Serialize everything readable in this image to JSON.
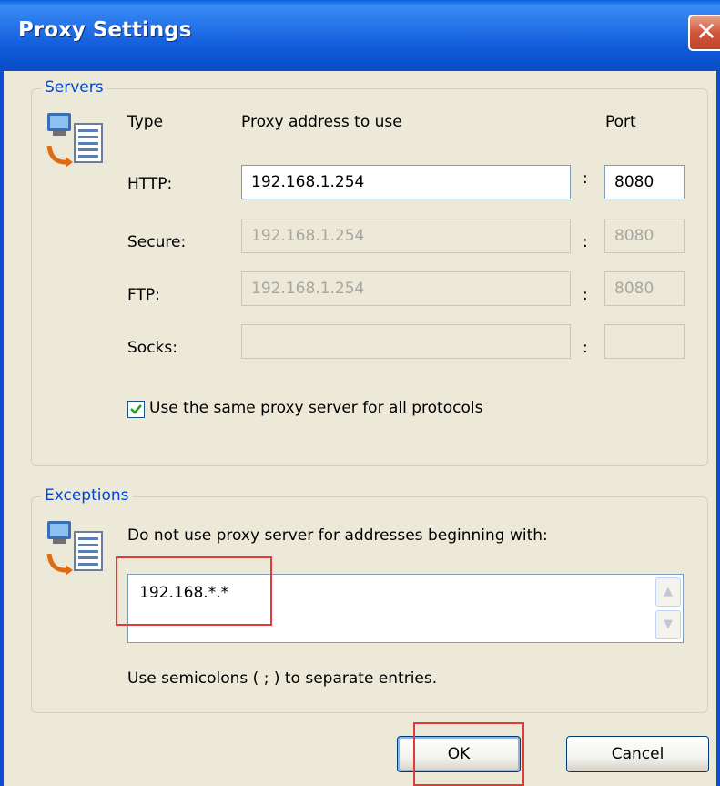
{
  "window": {
    "title": "Proxy Settings",
    "close_glyph": "✕"
  },
  "servers": {
    "group_label": "Servers",
    "icon": "network-computer-icon",
    "col_type": "Type",
    "col_address": "Proxy address to use",
    "col_port": "Port",
    "rows": [
      {
        "label": "HTTP:",
        "address": "192.168.1.254",
        "port": "8080",
        "enabled": true
      },
      {
        "label": "Secure:",
        "address": "192.168.1.254",
        "port": "8080",
        "enabled": false
      },
      {
        "label": "FTP:",
        "address": "192.168.1.254",
        "port": "8080",
        "enabled": false
      },
      {
        "label": "Socks:",
        "address": "",
        "port": "",
        "enabled": false
      }
    ],
    "separator": ":",
    "same_proxy_label": "Use the same proxy server for all protocols",
    "same_proxy_checked": true
  },
  "exceptions": {
    "group_label": "Exceptions",
    "icon": "network-computer-icon",
    "instruction": "Do not use proxy server for addresses beginning with:",
    "value": "192.168.*.*",
    "hint": "Use semicolons ( ; ) to separate entries."
  },
  "buttons": {
    "ok": "OK",
    "cancel": "Cancel"
  },
  "colors": {
    "title_bar": "#0a5fde",
    "group_label": "#0046d5",
    "highlight": "#e23a3a"
  }
}
